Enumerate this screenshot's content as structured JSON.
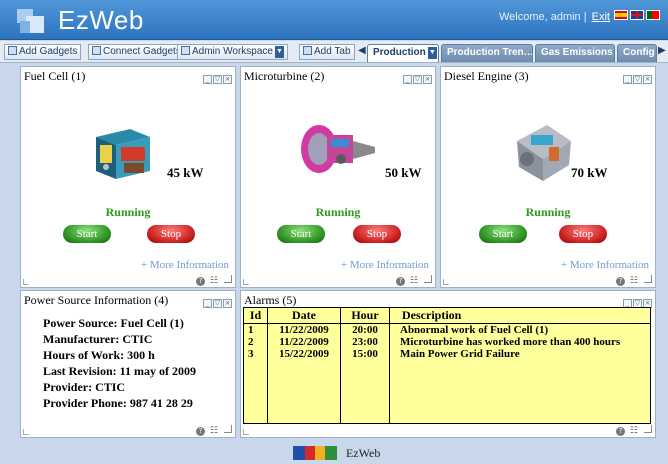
{
  "header": {
    "app_name": "EzWeb",
    "welcome_text": "Welcome, admin |",
    "exit_label": "Exit",
    "flags": [
      "es-flag",
      "uk-flag",
      "pt-flag"
    ]
  },
  "toolbar": {
    "add_gadgets": "Add Gadgets",
    "connect_gadgets": "Connect Gadgets",
    "workspace": "Admin Workspace",
    "add_tab": "Add Tab",
    "tabs": [
      {
        "label": "Production",
        "active": true
      },
      {
        "label": "Production Tren…",
        "active": false
      },
      {
        "label": "Gas Emissions",
        "active": false
      },
      {
        "label": "Config",
        "active": false
      }
    ]
  },
  "generators": [
    {
      "title": "Fuel Cell (1)",
      "power": "45 kW",
      "status": "Running",
      "start": "Start",
      "stop": "Stop",
      "more": "+ More Information",
      "image": "fuel-cell-image"
    },
    {
      "title": "Microturbine (2)",
      "power": "50 kW",
      "status": "Running",
      "start": "Start",
      "stop": "Stop",
      "more": "+ More Information",
      "image": "microturbine-image"
    },
    {
      "title": "Diesel Engine (3)",
      "power": "70 kW",
      "status": "Running",
      "start": "Start",
      "stop": "Stop",
      "more": "+ More Information",
      "image": "diesel-engine-image"
    }
  ],
  "power_source": {
    "title": "Power Source Information (4)",
    "lines": [
      "Power Source: Fuel Cell (1)",
      "Manufacturer: CTIC",
      "Hours of Work: 300 h",
      "Last Revision: 11 may of 2009",
      "Provider: CTIC",
      "Provider Phone: 987 41 28 29"
    ]
  },
  "alarms": {
    "title": "Alarms (5)",
    "columns": [
      "Id",
      "Date",
      "Hour",
      "Description"
    ],
    "rows": [
      [
        "1",
        "11/22/2009",
        "20:00",
        "Abnormal work of Fuel Cell (1)"
      ],
      [
        "2",
        "11/22/2009",
        "23:00",
        "Microturbine has worked more than 400 hours"
      ],
      [
        "3",
        "15/22/2009",
        "15:00",
        "Main Power Grid Failure"
      ]
    ]
  },
  "footer": {
    "brand": "EzWeb"
  },
  "colors": {
    "header": "#3a84cc",
    "running": "#2e9a1c",
    "start": "#2a8f1f",
    "stop": "#c81c1c",
    "link": "#6e9bd3",
    "alarm_bg": "#ffff9c"
  }
}
